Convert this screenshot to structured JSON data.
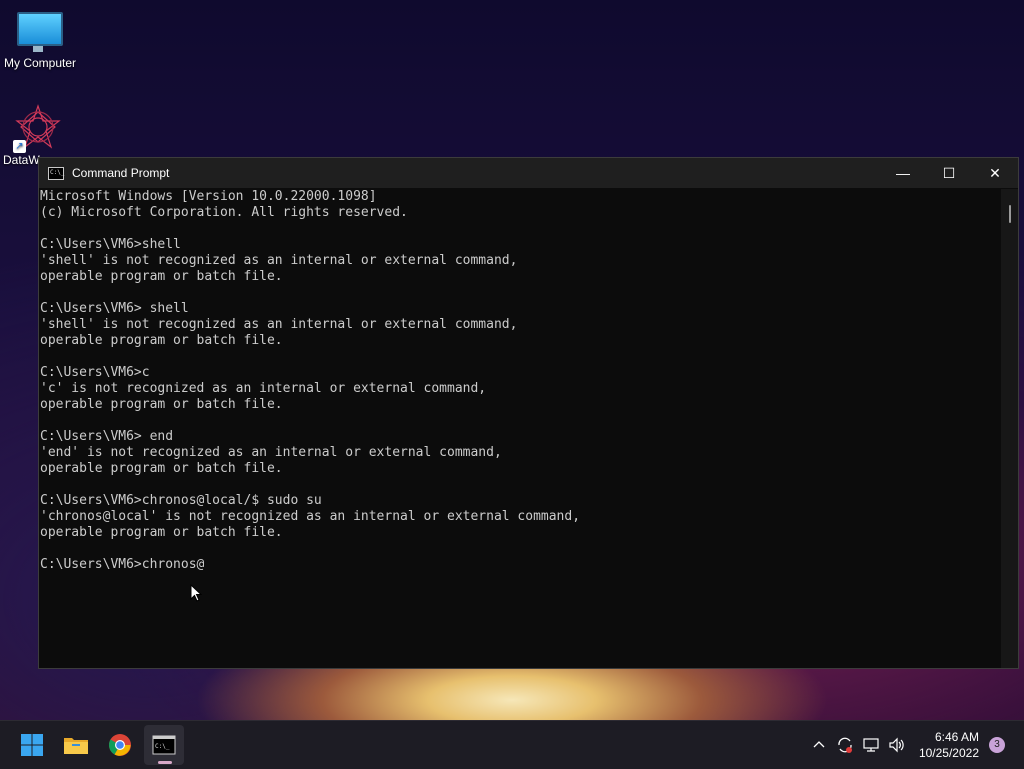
{
  "desktop": {
    "icons": [
      {
        "label": "My Computer"
      },
      {
        "label": "DataW"
      }
    ]
  },
  "window": {
    "title": "Command Prompt",
    "minimize_glyph": "—",
    "maximize_glyph": "☐",
    "close_glyph": "✕"
  },
  "terminal": {
    "lines": [
      "Microsoft Windows [Version 10.0.22000.1098]",
      "(c) Microsoft Corporation. All rights reserved.",
      "",
      "C:\\Users\\VM6>shell",
      "'shell' is not recognized as an internal or external command,",
      "operable program or batch file.",
      "",
      "C:\\Users\\VM6> shell",
      "'shell' is not recognized as an internal or external command,",
      "operable program or batch file.",
      "",
      "C:\\Users\\VM6>c",
      "'c' is not recognized as an internal or external command,",
      "operable program or batch file.",
      "",
      "C:\\Users\\VM6> end",
      "'end' is not recognized as an internal or external command,",
      "operable program or batch file.",
      "",
      "C:\\Users\\VM6>chronos@local/$ sudo su",
      "'chronos@local' is not recognized as an internal or external command,",
      "operable program or batch file.",
      "",
      "C:\\Users\\VM6>chronos@"
    ]
  },
  "taskbar": {
    "apps": [
      {
        "name": "start",
        "icon": "windows-logo-icon"
      },
      {
        "name": "file-explorer",
        "icon": "folder-icon"
      },
      {
        "name": "chrome",
        "icon": "chrome-icon"
      },
      {
        "name": "command-prompt",
        "icon": "terminal-icon",
        "active": true
      }
    ],
    "tray": {
      "time": "6:46 AM",
      "date": "10/25/2022",
      "notification_count": "3"
    }
  },
  "colors": {
    "terminal_bg": "#0c0c0c",
    "terminal_fg": "#cccccc",
    "titlebar_bg": "#1f1f1f",
    "taskbar_bg": "#1d1c24"
  }
}
